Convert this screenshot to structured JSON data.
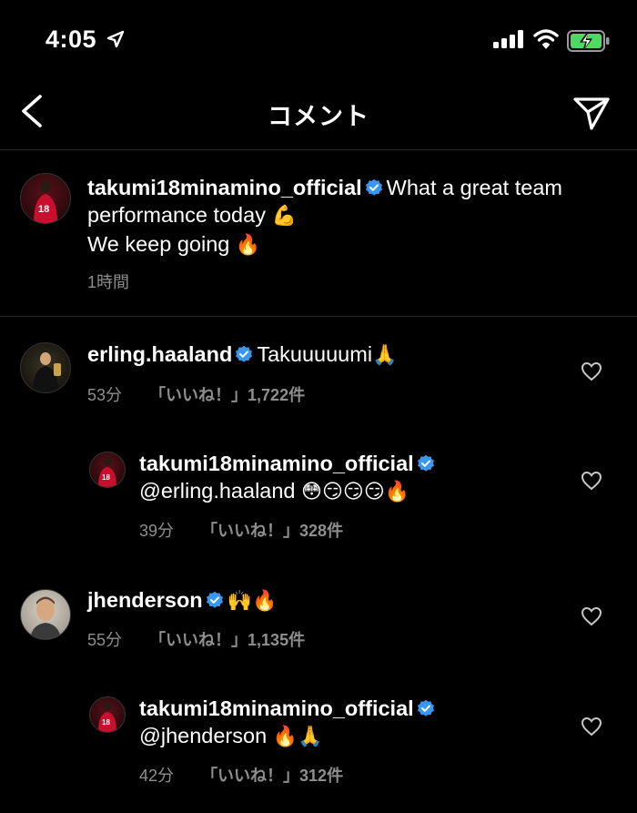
{
  "status_bar": {
    "time": "4:05"
  },
  "nav": {
    "title": "コメント"
  },
  "caption": {
    "username": "takumi18minamino_official",
    "text_line1": "What a great team",
    "text_line2": "performance today",
    "emoji_muscle": "💪",
    "text_line3": "We keep going",
    "emoji_fire": "🔥",
    "time": "1時間"
  },
  "comments": [
    {
      "username": "erling.haaland",
      "text": "Takuuuuumi",
      "emoji": "🙏",
      "time": "53分",
      "likes": "「いいね！」1,722件"
    },
    {
      "username": "takumi18minamino_official",
      "mention": "@erling.haaland",
      "emoji": "😳😏😏😏🔥",
      "time": "39分",
      "likes": "「いいね！」328件"
    },
    {
      "username": "jhenderson",
      "text": "",
      "emoji": "🙌🔥",
      "time": "55分",
      "likes": "「いいね！」1,135件"
    },
    {
      "username": "takumi18minamino_official",
      "mention": "@jhenderson",
      "emoji": "🔥🙏",
      "time": "42分",
      "likes": "「いいね！」312件"
    }
  ],
  "colors": {
    "background": "#000000",
    "verified": "#3897f0",
    "meta_gray": "#8e8e8e",
    "battery_green": "#4cd964"
  },
  "icons": [
    "location-arrow-icon",
    "signal-icon",
    "wifi-icon",
    "battery-charging-icon",
    "back-chevron-icon",
    "send-icon",
    "verified-badge-icon",
    "heart-icon"
  ]
}
